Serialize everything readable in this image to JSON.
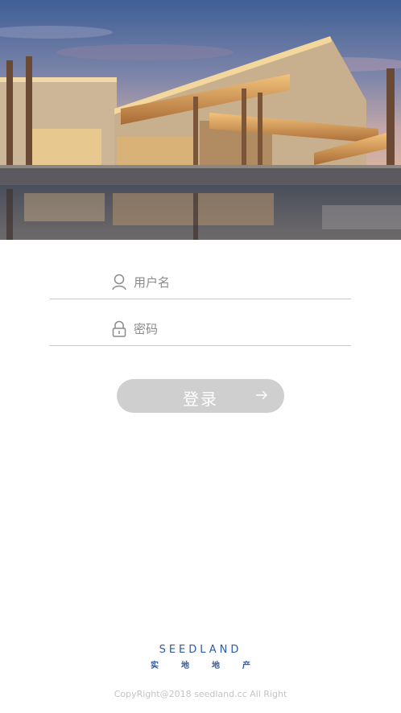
{
  "login": {
    "username_placeholder": "用户名",
    "password_placeholder": "密码",
    "submit_label": "登录"
  },
  "brand": {
    "logo_text": "SEEDLAND",
    "cn_chars": [
      "实",
      "地",
      "地",
      "产"
    ]
  },
  "footer": {
    "copyright": "CopyRight@2018 seedland.cc All Right"
  },
  "colors": {
    "button_bg": "#cfcfcf",
    "brand_blue": "#2f5aa5"
  }
}
